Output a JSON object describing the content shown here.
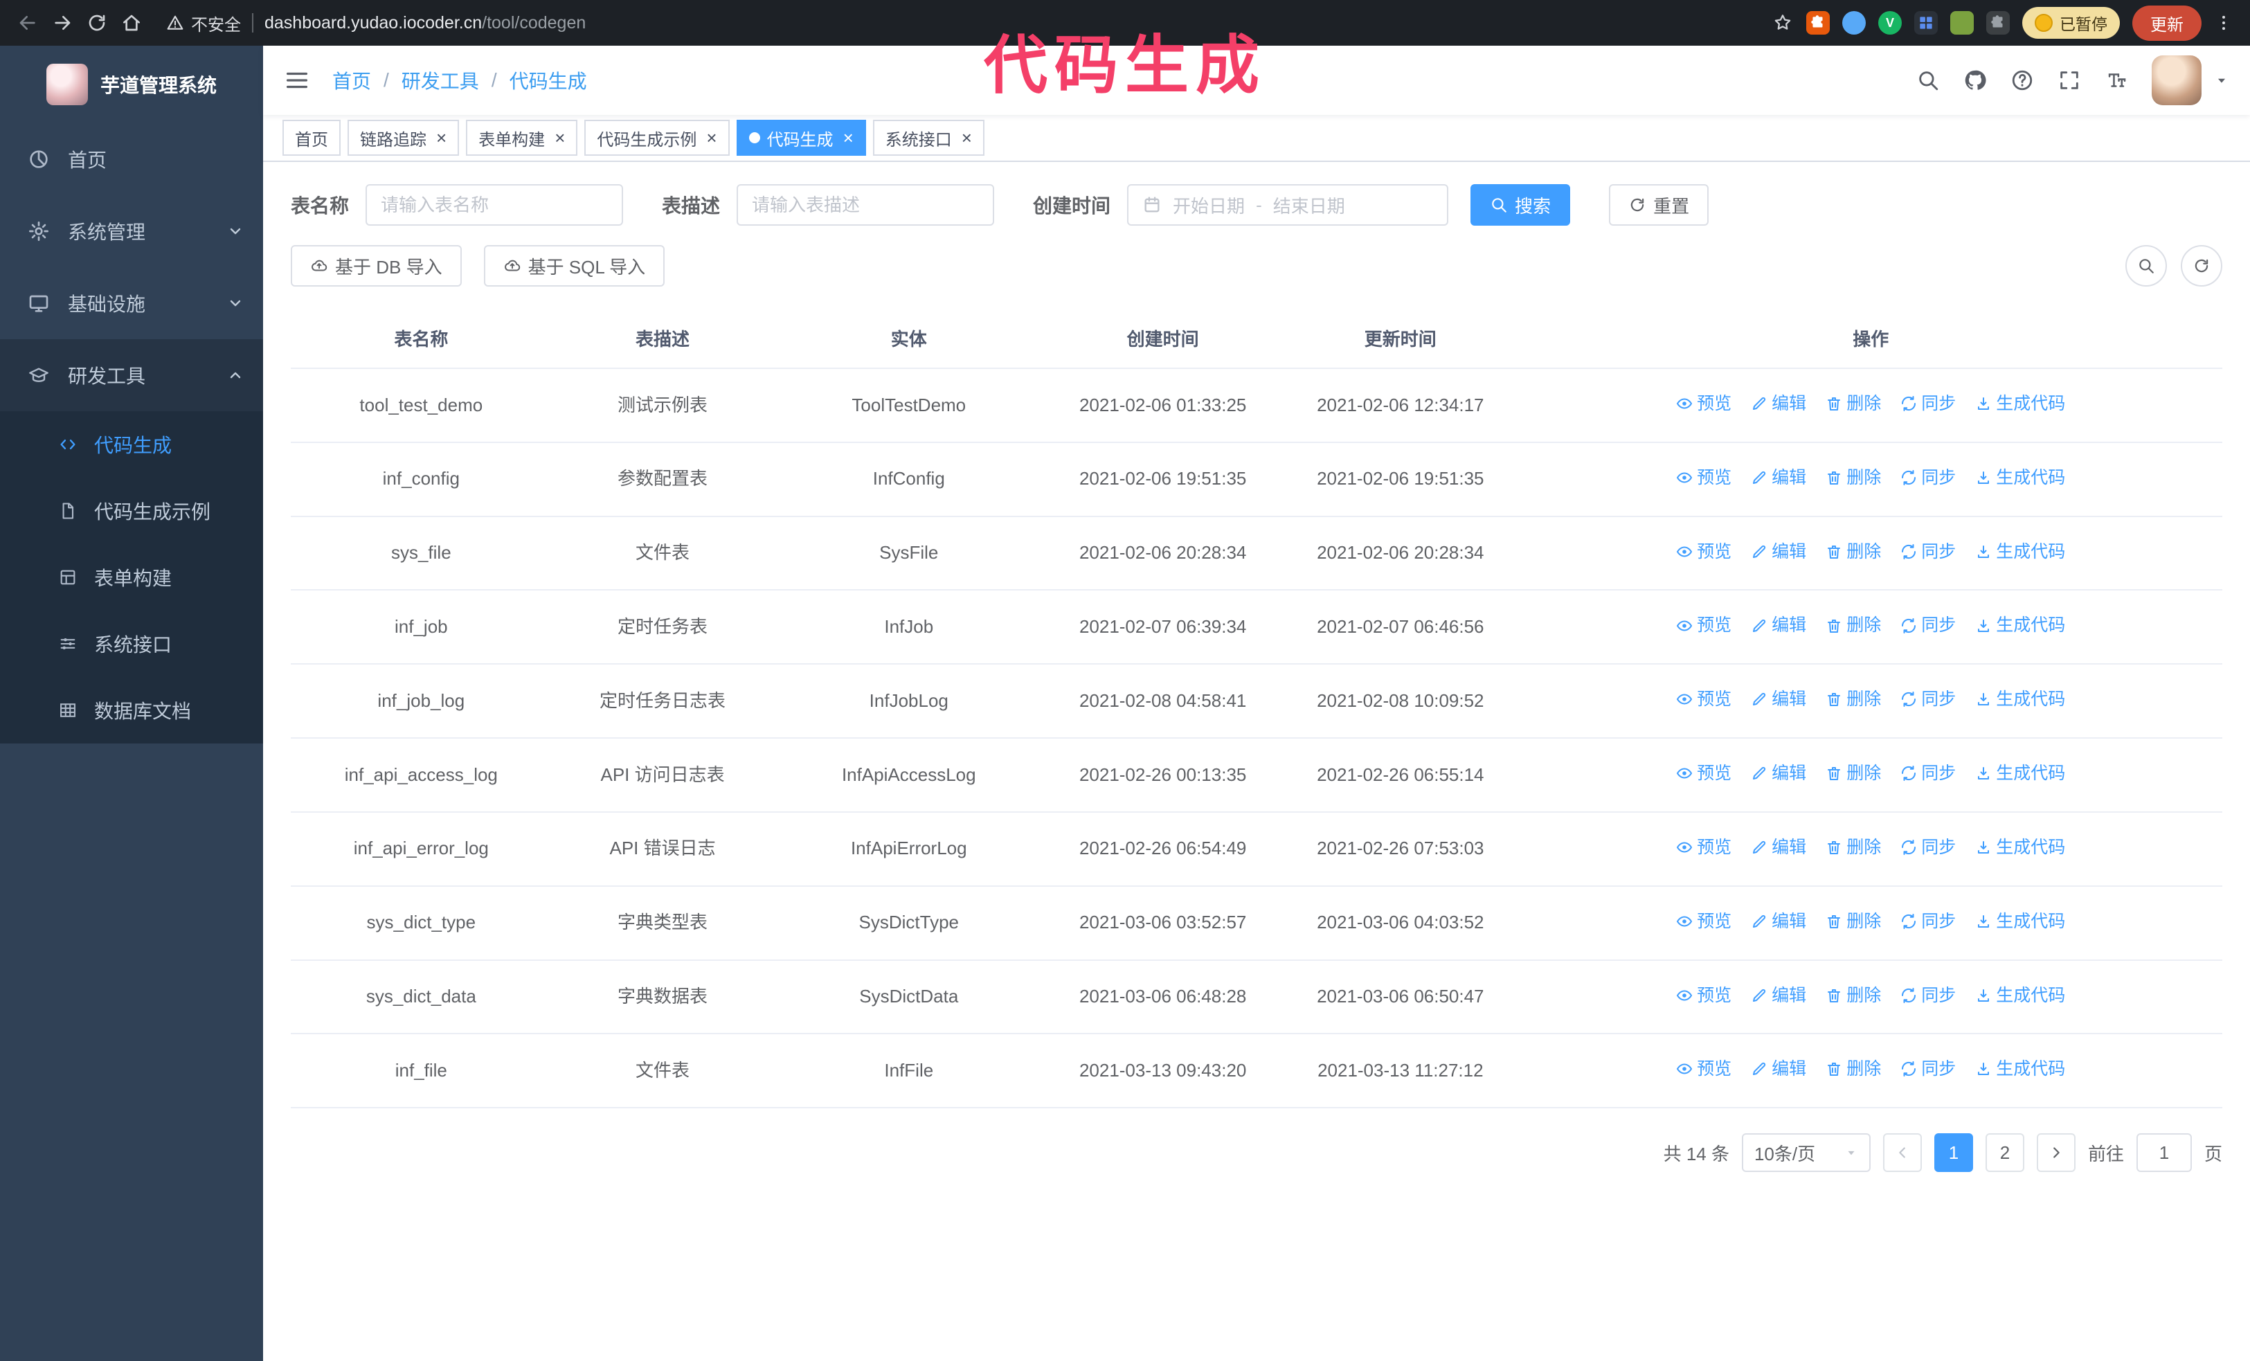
{
  "colors": {
    "accent": "#409eff",
    "annotation": "#f43f68",
    "sidebar_bg": "#304156",
    "submenu_bg": "#1f2d3d",
    "sidebar_active_bg": "#263445",
    "chrome_bg": "#1d2126",
    "update_button_bg": "#cc4a36",
    "paused_badge_bg": "#f3dfa0"
  },
  "annotation": {
    "text": "代码生成"
  },
  "browser": {
    "security_label": "不安全",
    "url_host": "dashboard.yudao.iocoder.cn",
    "url_path": "/tool/codegen",
    "extension_check_label": "V",
    "paused_badge": "已暂停",
    "update_label": "更新"
  },
  "sidebar": {
    "title": "芋道管理系统",
    "menu": [
      {
        "label": "首页"
      },
      {
        "label": "系统管理"
      },
      {
        "label": "基础设施"
      },
      {
        "label": "研发工具"
      }
    ],
    "submenu": [
      {
        "label": "代码生成"
      },
      {
        "label": "代码生成示例"
      },
      {
        "label": "表单构建"
      },
      {
        "label": "系统接口"
      },
      {
        "label": "数据库文档"
      }
    ]
  },
  "breadcrumb": [
    "首页",
    "研发工具",
    "代码生成"
  ],
  "tabs": [
    {
      "label": "首页"
    },
    {
      "label": "链路追踪"
    },
    {
      "label": "表单构建"
    },
    {
      "label": "代码生成示例"
    },
    {
      "label": "代码生成"
    },
    {
      "label": "系统接口"
    }
  ],
  "filters": {
    "table_name_label": "表名称",
    "table_name_placeholder": "请输入表名称",
    "table_desc_label": "表描述",
    "table_desc_placeholder": "请输入表描述",
    "create_time_label": "创建时间",
    "start_placeholder": "开始日期",
    "range_separator": "-",
    "end_placeholder": "结束日期",
    "search_label": "搜索",
    "reset_label": "重置"
  },
  "toolbar": {
    "import_db_label": "基于 DB 导入",
    "import_sql_label": "基于 SQL 导入"
  },
  "table": {
    "columns": [
      "表名称",
      "表描述",
      "实体",
      "创建时间",
      "更新时间",
      "操作"
    ],
    "actions": [
      {
        "label": "预览",
        "icon": "eye-icon",
        "name": "preview-link"
      },
      {
        "label": "编辑",
        "icon": "edit-icon",
        "name": "edit-link"
      },
      {
        "label": "删除",
        "icon": "delete-icon",
        "name": "delete-link"
      },
      {
        "label": "同步",
        "icon": "sync-icon",
        "name": "sync-link"
      },
      {
        "label": "生成代码",
        "icon": "download-icon",
        "name": "generate-code-link"
      }
    ],
    "rows": [
      {
        "name": "tool_test_demo",
        "desc": "测试示例表",
        "entity": "ToolTestDemo",
        "created": "2021-02-06 01:33:25",
        "updated": "2021-02-06 12:34:17"
      },
      {
        "name": "inf_config",
        "desc": "参数配置表",
        "entity": "InfConfig",
        "created": "2021-02-06 19:51:35",
        "updated": "2021-02-06 19:51:35"
      },
      {
        "name": "sys_file",
        "desc": "文件表",
        "entity": "SysFile",
        "created": "2021-02-06 20:28:34",
        "updated": "2021-02-06 20:28:34"
      },
      {
        "name": "inf_job",
        "desc": "定时任务表",
        "entity": "InfJob",
        "created": "2021-02-07 06:39:34",
        "updated": "2021-02-07 06:46:56"
      },
      {
        "name": "inf_job_log",
        "desc": "定时任务日志表",
        "entity": "InfJobLog",
        "created": "2021-02-08 04:58:41",
        "updated": "2021-02-08 10:09:52"
      },
      {
        "name": "inf_api_access_log",
        "desc": "API 访问日志表",
        "entity": "InfApiAccessLog",
        "created": "2021-02-26 00:13:35",
        "updated": "2021-02-26 06:55:14"
      },
      {
        "name": "inf_api_error_log",
        "desc": "API 错误日志",
        "entity": "InfApiErrorLog",
        "created": "2021-02-26 06:54:49",
        "updated": "2021-02-26 07:53:03"
      },
      {
        "name": "sys_dict_type",
        "desc": "字典类型表",
        "entity": "SysDictType",
        "created": "2021-03-06 03:52:57",
        "updated": "2021-03-06 04:03:52"
      },
      {
        "name": "sys_dict_data",
        "desc": "字典数据表",
        "entity": "SysDictData",
        "created": "2021-03-06 06:48:28",
        "updated": "2021-03-06 06:50:47"
      },
      {
        "name": "inf_file",
        "desc": "文件表",
        "entity": "InfFile",
        "created": "2021-03-13 09:43:20",
        "updated": "2021-03-13 11:27:12"
      }
    ]
  },
  "pagination": {
    "total_text": "共 14 条",
    "page_size_label": "10条/页",
    "pages": [
      "1",
      "2"
    ],
    "active_page": "1",
    "goto_prefix": "前往",
    "goto_value": "1",
    "goto_suffix": "页"
  }
}
